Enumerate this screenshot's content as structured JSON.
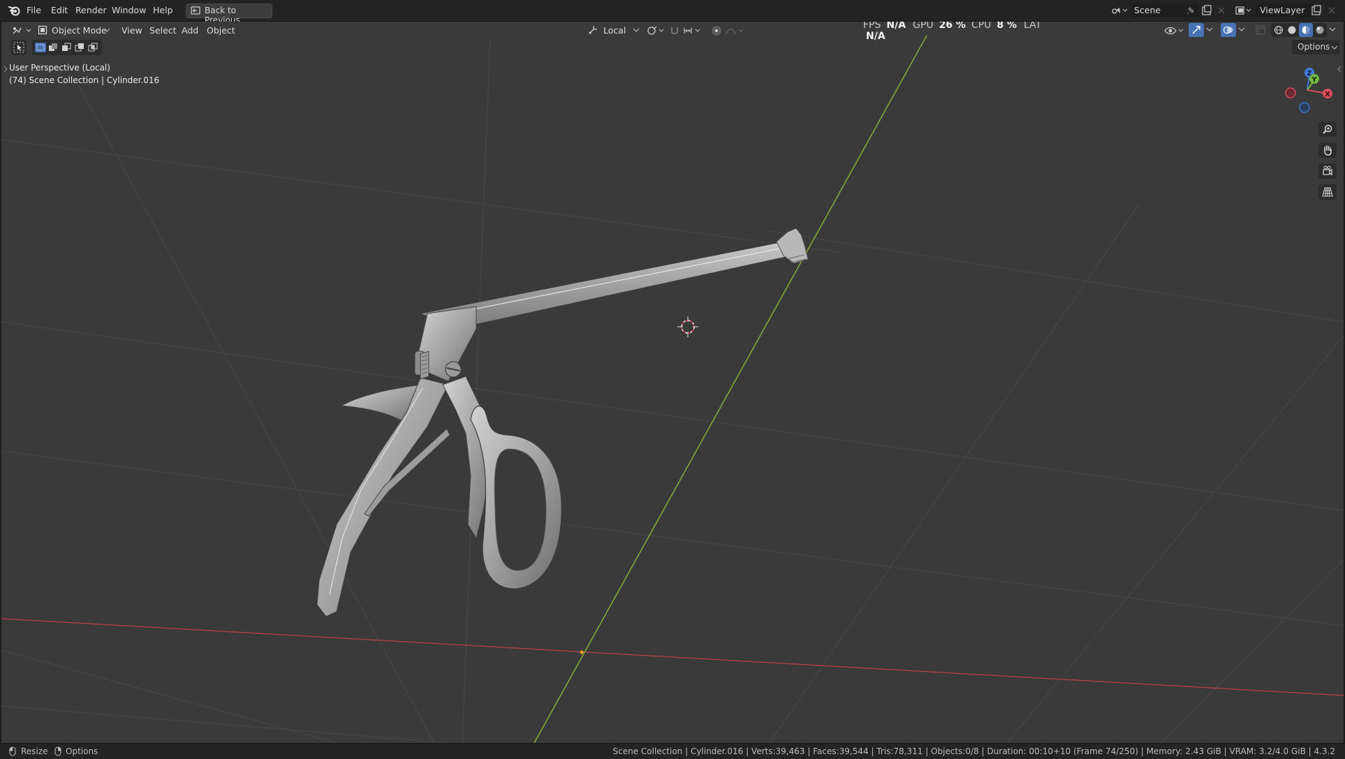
{
  "menu": {
    "file": "File",
    "edit": "Edit",
    "render": "Render",
    "window": "Window",
    "help": "Help",
    "back_to_previous": "Back to Previous"
  },
  "top_right": {
    "scene": "Scene",
    "view_layer": "ViewLayer"
  },
  "viewport_header": {
    "mode": "Object Mode",
    "view": "View",
    "select": "Select",
    "add": "Add",
    "object": "Object",
    "orientation": "Local",
    "options": "Options"
  },
  "perf": {
    "fps_label": "FPS",
    "fps_value": "N/A",
    "gpu_label": "GPU",
    "gpu_value": "26 %",
    "cpu_label": "CPU",
    "cpu_value": "8 %",
    "lat_label": "LAT",
    "lat_value": "N/A"
  },
  "overlay": {
    "perspective": "User Perspective (Local)",
    "collection": "(74) Scene Collection | Cylinder.016"
  },
  "gizmo": {
    "z": "Z",
    "y": "Y",
    "x": "X"
  },
  "status": {
    "resize": "Resize",
    "options": "Options",
    "info": "Scene Collection | Cylinder.016 | Verts:39,463 | Faces:39,544 | Tris:78,311 | Objects:0/8 | Duration: 00:10+10 (Frame 74/250) | Memory: 2.43 GiB | VRAM: 3.2/4.0 GiB | 4.3.2"
  },
  "colors": {
    "viewport_bg": "#3a3a3a",
    "x_axis": "#c0444e",
    "y_axis": "#7fa83a",
    "gizmo_x": "#e04d5f",
    "gizmo_y": "#73b840",
    "gizmo_z": "#3f7bd8",
    "active_blue": "#4772b3"
  },
  "icons": [
    "blender-logo-icon",
    "editor-type-icon",
    "object-mode-icon",
    "select-box-icon",
    "transform-orientation-icon",
    "pivot-icon",
    "snap-icon",
    "proportional-edit-icon",
    "visibility-icon",
    "gizmo-toggle-icon",
    "overlay-icon",
    "xray-icon",
    "wireframe-shading-icon",
    "solid-shading-icon",
    "material-shading-icon",
    "rendered-shading-icon",
    "zoom-icon",
    "pan-hand-icon",
    "camera-view-icon",
    "perspective-grid-icon",
    "3d-cursor-icon",
    "mouse-icon"
  ]
}
